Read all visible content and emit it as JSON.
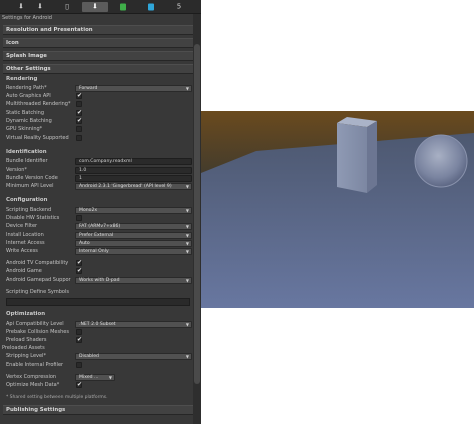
{
  "settings_title": "Settings for Android",
  "platform_tabs": [
    {
      "icon": "standalone-download-icon",
      "glyph": "⬇",
      "selected": false
    },
    {
      "icon": "standalone-arrow-icon",
      "glyph": "⬇",
      "selected": false
    },
    {
      "icon": "ios-phone-icon",
      "glyph": "▯",
      "selected": false
    },
    {
      "icon": "android-icon",
      "glyph": "⬇",
      "selected": true
    },
    {
      "icon": "xbox-icon",
      "glyph": "■",
      "selected": false,
      "color": "#3fae49"
    },
    {
      "icon": "web-icon",
      "glyph": "■",
      "selected": false,
      "color": "#2fa6d9"
    },
    {
      "icon": "html5-icon",
      "glyph": "5",
      "selected": false
    }
  ],
  "sections": {
    "resolution": "Resolution and Presentation",
    "icon": "Icon",
    "splash": "Splash Image",
    "other": "Other Settings",
    "publishing": "Publishing Settings"
  },
  "rendering": {
    "title": "Rendering",
    "rendering_path_label": "Rendering Path*",
    "rendering_path_value": "Forward",
    "auto_graphics_label": "Auto Graphics API",
    "multithreaded_label": "Multithreaded Rendering*",
    "static_batching_label": "Static Batching",
    "dynamic_batching_label": "Dynamic Batching",
    "gpu_skinning_label": "GPU Skinning*",
    "virtual_reality_label": "Virtual Reality Supported"
  },
  "identification": {
    "title": "Identification",
    "bundle_id_label": "Bundle Identifier",
    "bundle_id_value": "com.Company.readxml",
    "version_label": "Version*",
    "version_value": "1.0",
    "bundle_version_label": "Bundle Version Code",
    "bundle_version_value": "1",
    "min_api_label": "Minimum API Level",
    "min_api_value": "Android 2.3.1 'Gingerbread' (API level 9)"
  },
  "configuration": {
    "title": "Configuration",
    "scripting_backend_label": "Scripting Backend",
    "scripting_backend_value": "Mono2x",
    "disable_hw_stats_label": "Disable HW Statistics",
    "device_filter_label": "Device Filter",
    "device_filter_value": "FAT (ARMv7+x86)",
    "install_location_label": "Install Location",
    "install_location_value": "Prefer External",
    "internet_access_label": "Internet Access",
    "internet_access_value": "Auto",
    "write_access_label": "Write Access",
    "write_access_value": "Internal Only",
    "android_tv_label": "Android TV Compatibility",
    "android_game_label": "Android Game",
    "gamepad_label": "Android Gamepad Suppor",
    "gamepad_value": "Works with D-pad",
    "define_symbols_label": "Scripting Define Symbols"
  },
  "optimization": {
    "title": "Optimization",
    "api_compat_label": "Api Compatibility Level",
    "api_compat_value": ".NET 2.0 Subset",
    "prebake_label": "Prebake Collision Meshes",
    "preload_shaders_label": "Preload Shaders",
    "preloaded_assets_label": "Preloaded Assets",
    "stripping_label": "Stripping Level*",
    "stripping_value": "Disabled",
    "internal_profiler_label": "Enable Internal Profiler",
    "vertex_compression_label": "Vertex Compression",
    "vertex_compression_value": "Mixed ...",
    "optimize_mesh_label": "Optimize Mesh Data*"
  },
  "checkboxes": {
    "auto_graphics": true,
    "multithreaded": false,
    "static_batching": true,
    "dynamic_batching": true,
    "gpu_skinning": false,
    "virtual_reality": false,
    "disable_hw_stats": false,
    "android_tv": true,
    "android_game": true,
    "prebake": false,
    "preload_shaders": true,
    "internal_profiler": false,
    "optimize_mesh": true
  },
  "shared_note": "* Shared setting between multiple platforms.",
  "viewport": {
    "sky_color": "#5d4420",
    "ground_color": "#5a6a86"
  }
}
